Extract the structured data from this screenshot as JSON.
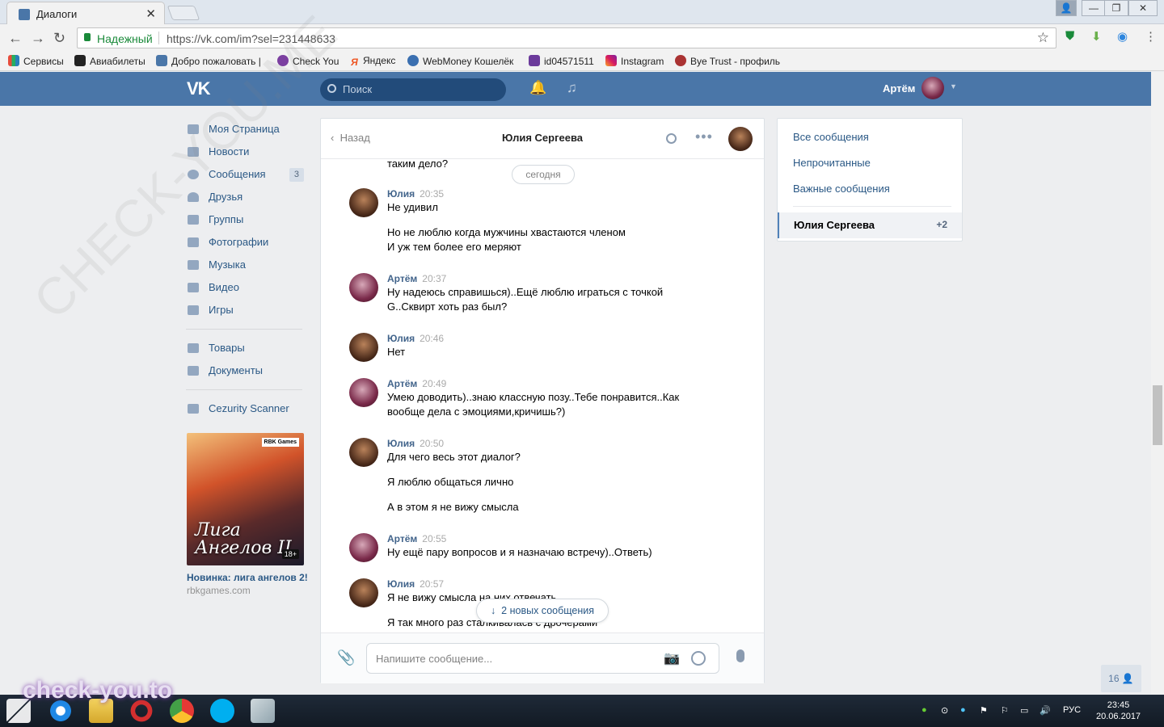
{
  "browser": {
    "tab_title": "Диалоги",
    "secure_label": "Надежный",
    "url": "https://vk.com/im?sel=231448633",
    "bookmarks": [
      "Сервисы",
      "Авиабилеты",
      "Добро пожаловать |",
      "Check You",
      "Яндекс",
      "WebMoney Кошелёк",
      "id04571511",
      "Instagram",
      "Bye Trust - профиль"
    ]
  },
  "header": {
    "logo": "VK",
    "search_placeholder": "Поиск",
    "user_name": "Артём"
  },
  "menu": {
    "items": [
      "Моя Страница",
      "Новости",
      "Сообщения",
      "Друзья",
      "Группы",
      "Фотографии",
      "Музыка",
      "Видео",
      "Игры"
    ],
    "messages_count": "3",
    "items2": [
      "Товары",
      "Документы"
    ],
    "items3": [
      "Cezurity Scanner"
    ]
  },
  "ad": {
    "image_text": "Лига Ангелов II",
    "badge": "RBK Games",
    "age": "18+",
    "title": "Новинка: лига ангелов 2!",
    "source": "rbkgames.com"
  },
  "dialog": {
    "back_label": "Назад",
    "peer_name": "Юлия Сергеева",
    "clipped_text": "таким дело?",
    "date_divider": "сегодня",
    "messages": [
      {
        "author": "Юлия",
        "time": "20:35",
        "lines": [
          "Не удивил",
          "",
          "Но не люблю когда мужчины хвастаются членом",
          "И уж тем более его меряют"
        ]
      },
      {
        "author": "Артём",
        "time": "20:37",
        "lines": [
          "Ну надеюсь справишься)..Ещё люблю играться с точкой",
          "G..Сквирт хоть раз был?"
        ]
      },
      {
        "author": "Юлия",
        "time": "20:46",
        "lines": [
          "Нет"
        ]
      },
      {
        "author": "Артём",
        "time": "20:49",
        "lines": [
          "Умею доводить)..знаю классную позу..Тебе понравится..Как",
          "вообще дела с эмоциями,кричишь?)"
        ]
      },
      {
        "author": "Юлия",
        "time": "20:50",
        "lines": [
          "Для чего весь этот диалог?",
          "",
          "Я люблю общаться лично",
          "",
          "А в этом я не вижу смысла"
        ]
      },
      {
        "author": "Артём",
        "time": "20:55",
        "lines": [
          "Ну ещё пару вопросов и я назначаю встречу)..Ответь)"
        ]
      },
      {
        "author": "Юлия",
        "time": "20:57",
        "lines": [
          "Я не вижу смысла на них отвечать",
          "",
          "Я так много раз сталкивалась с дрочерами"
        ]
      }
    ],
    "new_messages_label": "2 новых сообщения",
    "composer_placeholder": "Напишите сообщение..."
  },
  "right_panel": {
    "filters": [
      "Все сообщения",
      "Непрочитанные",
      "Важные сообщения"
    ],
    "selected_name": "Юлия Сергеева",
    "selected_count": "+2"
  },
  "online_count": "16",
  "taskbar": {
    "lang": "РУС",
    "time": "23:45",
    "date": "20.06.2017"
  },
  "watermark": {
    "site": "check-you.to",
    "diagonal": "CHECK-YOU.ME"
  }
}
